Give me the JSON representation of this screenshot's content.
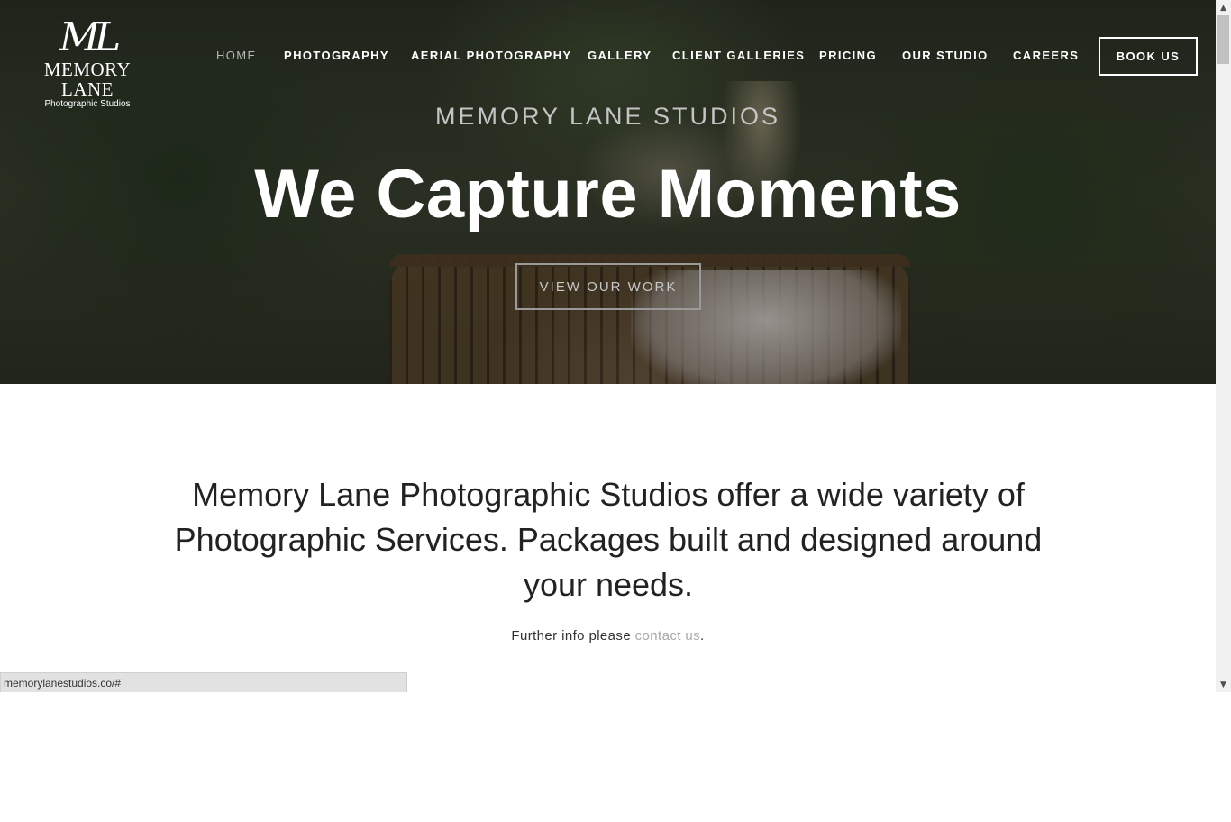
{
  "logo": {
    "mark": "ML",
    "name": "MEMORY LANE",
    "subtitle": "Photographic Studios"
  },
  "nav": {
    "items": [
      {
        "label": "HOME",
        "active": true
      },
      {
        "label": "PHOTOGRAPHY"
      },
      {
        "label": "AERIAL PHOTOGRAPHY"
      },
      {
        "label": "GALLERY"
      },
      {
        "label": "CLIENT GALLERIES"
      },
      {
        "label": "PRICING"
      },
      {
        "label": "OUR STUDIO"
      },
      {
        "label": "CAREERS"
      }
    ],
    "cta_label": "BOOK US"
  },
  "hero": {
    "kicker": "MEMORY LANE STUDIOS",
    "title": "We Capture Moments",
    "button_label": "VIEW OUR WORK"
  },
  "intro": {
    "text": "Memory Lane Photographic Studios offer a wide variety of Photographic Services. Packages built and designed around your needs.",
    "further_prefix": "Further info please ",
    "contact_link": "contact us",
    "further_suffix": "."
  },
  "status_bar": {
    "url": "memorylanestudios.co/#"
  },
  "icons": {
    "scroll_up": "triangle-up-icon",
    "scroll_down": "triangle-down-icon"
  },
  "colors": {
    "nav_text": "#ffffff",
    "nav_active": "#b9b9b9",
    "link": "#a8a8a8",
    "body_text": "#222222"
  }
}
